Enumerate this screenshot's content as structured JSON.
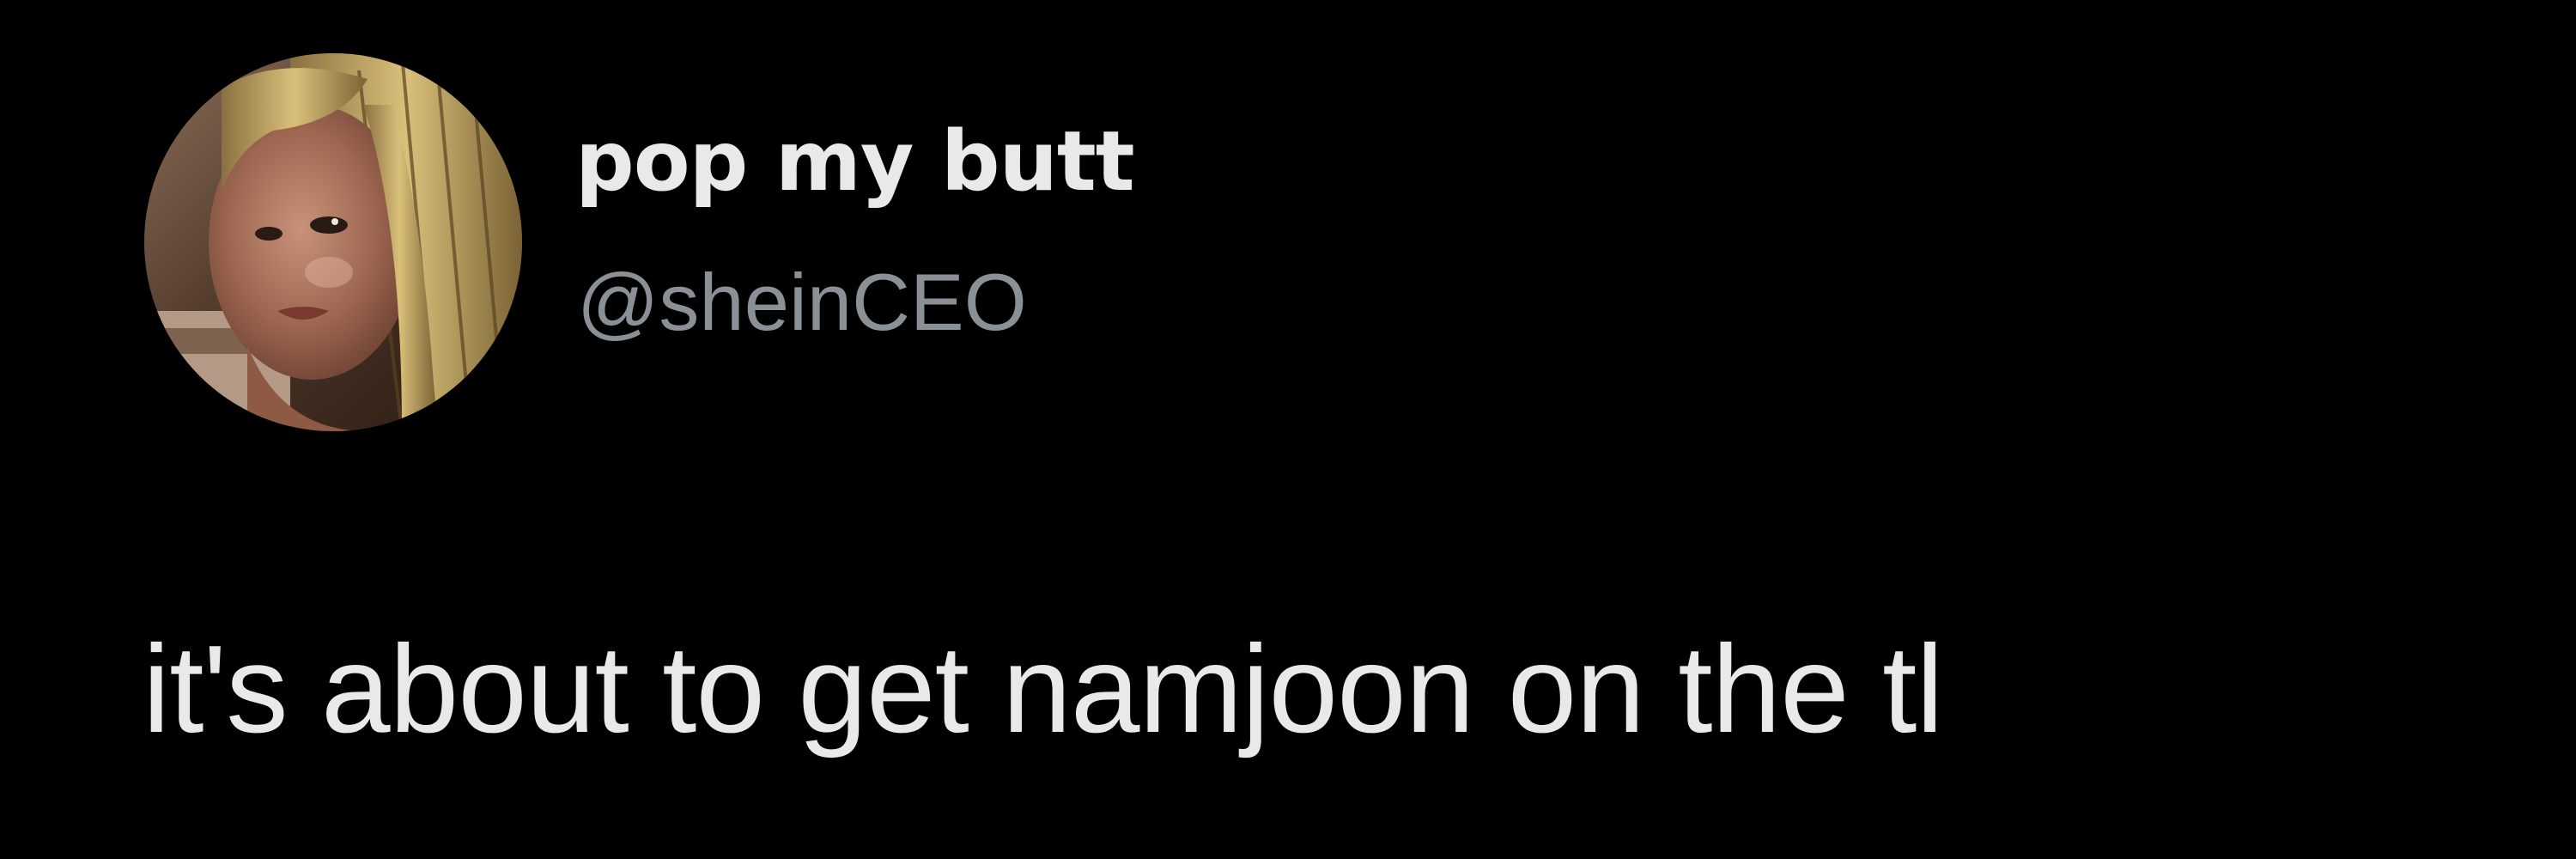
{
  "tweet": {
    "author": {
      "display_name": "pop my butt",
      "handle": "@sheinCEO",
      "avatar_icon": "profile-photo"
    },
    "text": "it's about to get namjoon on the tl"
  },
  "colors": {
    "background": "#000000",
    "primary_text": "#e7e9ea",
    "secondary_text": "#8b9096"
  }
}
